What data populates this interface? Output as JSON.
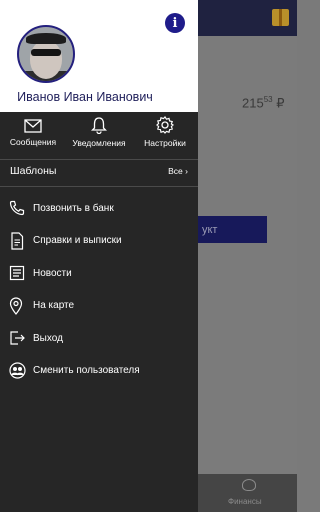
{
  "background": {
    "balance_main": "215",
    "balance_fraction": "53",
    "currency": "₽",
    "button_label": "укт",
    "bottom_tab_label": "Финансы"
  },
  "profile": {
    "name": "Иванов Иван Иванович",
    "info_label": "i"
  },
  "quick_actions": [
    {
      "label": "Сообщения",
      "icon": "envelope-icon"
    },
    {
      "label": "Уведомления",
      "icon": "bell-icon"
    },
    {
      "label": "Настройки",
      "icon": "gear-icon"
    }
  ],
  "templates": {
    "label": "Шаблоны",
    "all_label": "Все",
    "chevron": "›"
  },
  "menu": [
    {
      "label": "Позвонить в банк",
      "icon": "phone-icon"
    },
    {
      "label": "Справки и выписки",
      "icon": "document-icon"
    },
    {
      "label": "Новости",
      "icon": "news-icon"
    },
    {
      "label": "На карте",
      "icon": "map-pin-icon"
    },
    {
      "label": "Выход",
      "icon": "exit-icon"
    },
    {
      "label": "Сменить пользователя",
      "icon": "switch-user-icon"
    }
  ]
}
